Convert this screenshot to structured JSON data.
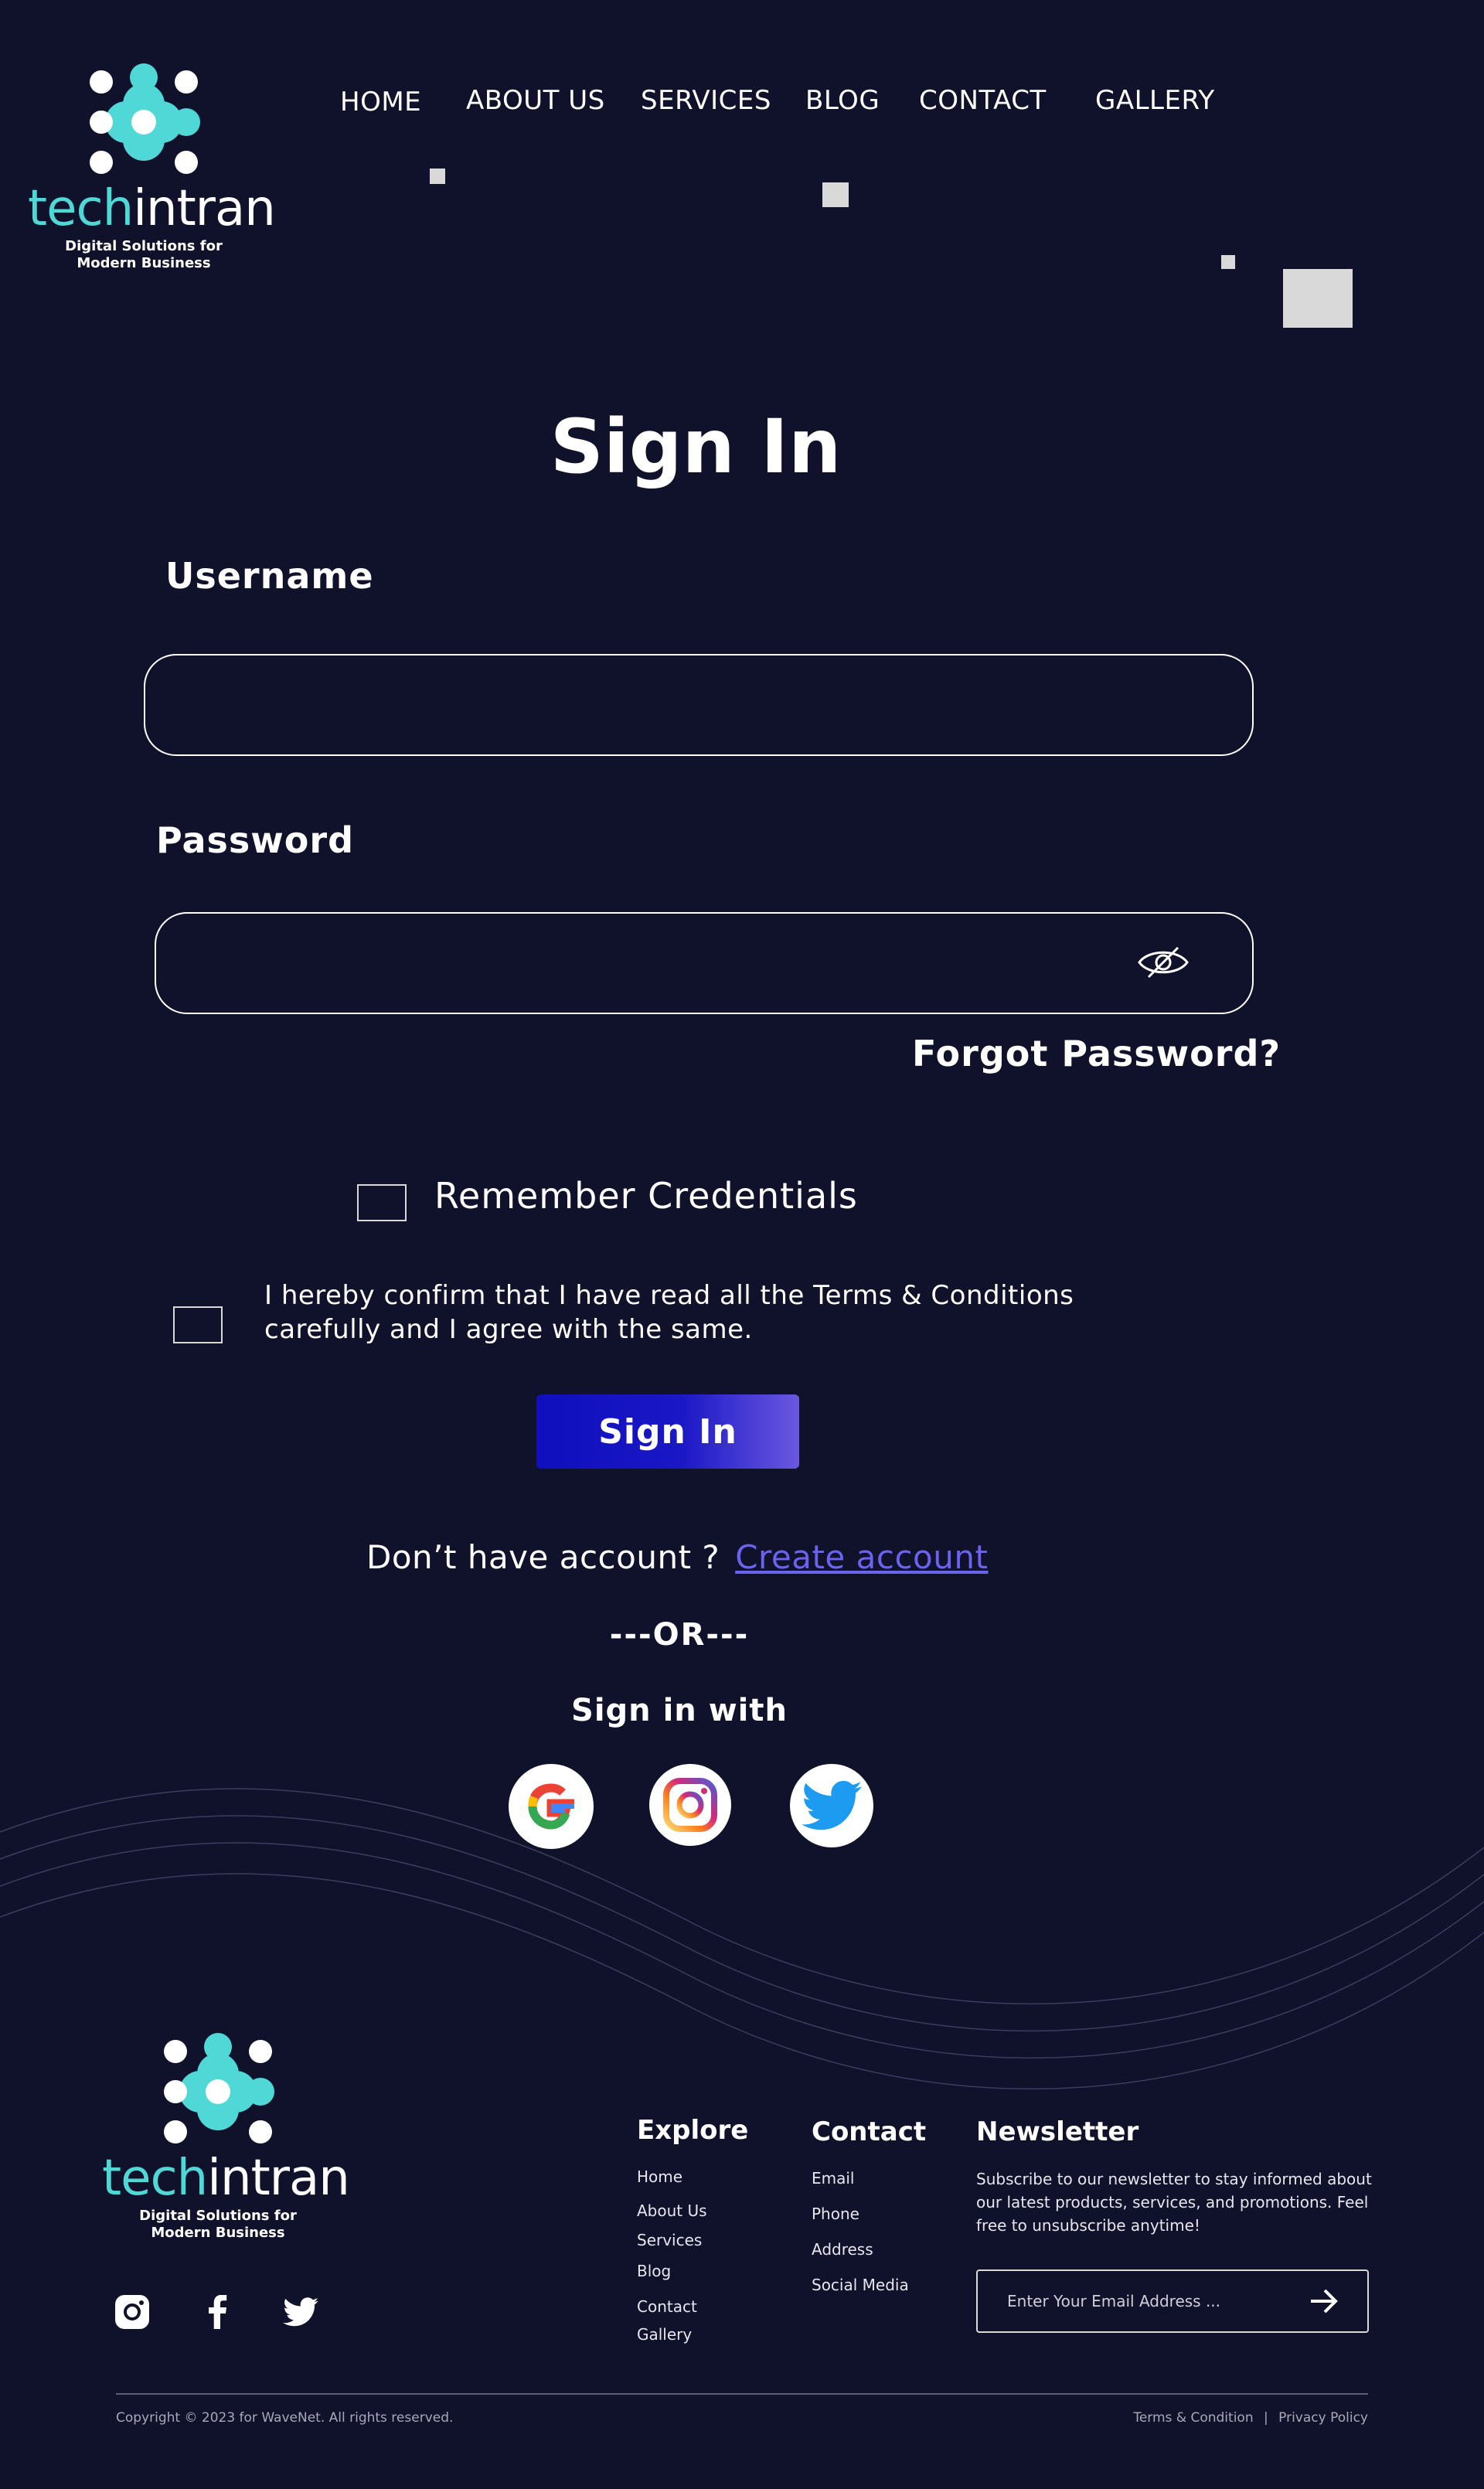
{
  "brand": {
    "name_part1": "tech",
    "name_part2": "intran",
    "tagline": "Digital Solutions for\nModern Business",
    "accent_color": "#4fd8d6"
  },
  "nav": {
    "items": [
      {
        "label": "HOME"
      },
      {
        "label": "ABOUT US"
      },
      {
        "label": "SERVICES"
      },
      {
        "label": "BLOG"
      },
      {
        "label": "CONTACT"
      },
      {
        "label": "GALLERY"
      }
    ]
  },
  "form": {
    "title": "Sign In",
    "username_label": "Username",
    "username_value": "",
    "password_label": "Password",
    "password_value": "",
    "password_toggle_icon": "eye-slash-icon",
    "forgot_password": "Forgot Password?",
    "remember_label": "Remember Credentials",
    "remember_checked": false,
    "terms_text": "I hereby confirm that I have read all the Terms & Conditions carefully and I agree with the same.",
    "terms_checked": false,
    "submit_label": "Sign In",
    "no_account_text": "Don’t have account ?",
    "create_account_link": "Create account",
    "or_divider": "---OR---",
    "social_heading": "Sign in with",
    "social_providers": [
      "google-icon",
      "instagram-icon",
      "twitter-icon"
    ]
  },
  "footer": {
    "explore": {
      "heading": "Explore",
      "links": [
        "Home",
        "About Us",
        "Services",
        "Blog",
        "Contact",
        "Gallery"
      ]
    },
    "contact": {
      "heading": "Contact",
      "links": [
        "Email",
        "Phone",
        "Address",
        "Social Media"
      ]
    },
    "newsletter": {
      "heading": "Newsletter",
      "description": "Subscribe to our newsletter to stay informed about our latest products, services, and promotions. Feel free to unsubscribe anytime!",
      "email_placeholder": "Enter Your Email Address ...",
      "email_value": "",
      "submit_icon": "arrow-right-icon"
    },
    "social_icons": [
      "instagram-icon",
      "facebook-icon",
      "twitter-icon"
    ],
    "copyright": "Copyright © 2023 for WaveNet. All rights reserved.",
    "legal_links": [
      "Terms & Condition",
      "Privacy Policy"
    ],
    "legal_separator": "|"
  },
  "colors": {
    "background": "#10112b",
    "button_gradient_start": "#0f0fbd",
    "button_gradient_end": "#6b58e0",
    "link": "#6b62ee"
  }
}
